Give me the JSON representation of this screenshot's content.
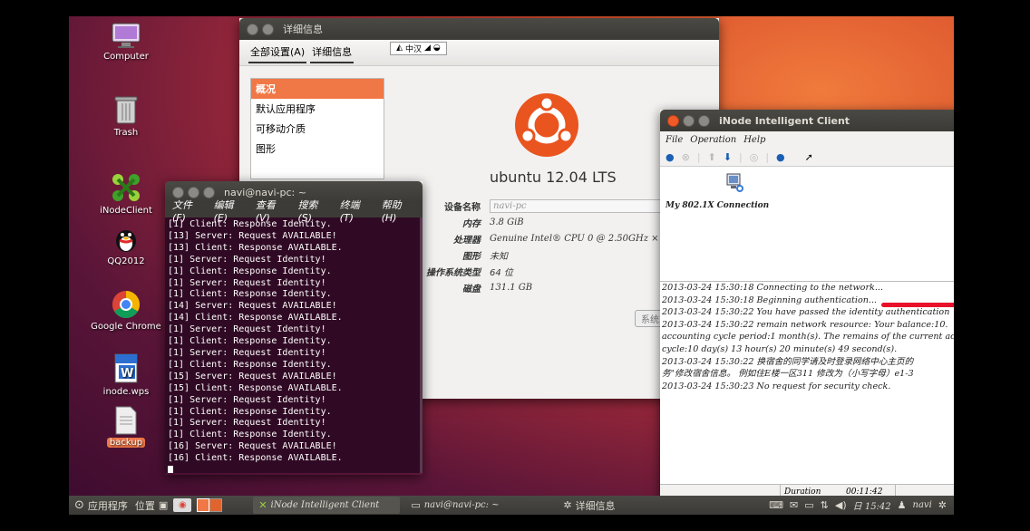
{
  "desktop": {
    "icons": [
      {
        "label": "Computer",
        "icon": "computer-icon"
      },
      {
        "label": "Trash",
        "icon": "trash-icon"
      },
      {
        "label": "iNodeClient",
        "icon": "inode-client-icon"
      },
      {
        "label": "QQ2012",
        "icon": "qq-icon"
      },
      {
        "label": "Google Chrome",
        "icon": "chrome-icon"
      },
      {
        "label": "inode.wps",
        "icon": "wps-document-icon"
      },
      {
        "label": "backup",
        "icon": "text-file-icon"
      }
    ]
  },
  "details": {
    "title": "详细信息",
    "toolbar_all_settings": "全部设置(A)",
    "toolbar_details": "详细信息",
    "ime_label": "中汉",
    "sidebar": [
      "概况",
      "默认应用程序",
      "可移动介质",
      "图形"
    ],
    "os_name": "ubuntu 12.04 LTS",
    "device_name_label": "设备名称",
    "device_name_value": "navi-pc",
    "memory_label": "内存",
    "memory_value": "3.8 GiB",
    "cpu_label": "处理器",
    "cpu_value": "Genuine Intel® CPU 0 @ 2.50GHz × 4",
    "graphics_label": "图形",
    "graphics_value": "未知",
    "ostype_label": "操作系统类型",
    "ostype_value": "64 位",
    "disk_label": "磁盘",
    "disk_value": "131.1 GB",
    "update_button": "系统"
  },
  "terminal": {
    "title": "navi@navi-pc: ~",
    "menu": [
      "文件(F)",
      "编辑(E)",
      "查看(V)",
      "搜索(S)",
      "终端(T)",
      "帮助(H)"
    ],
    "lines": [
      "[1] Client: Response Identity.",
      "[13] Server: Request AVAILABLE!",
      "[13] Client: Response AVAILABLE.",
      "[1] Server: Request Identity!",
      "[1] Client: Response Identity.",
      "[1] Server: Request Identity!",
      "[1] Client: Response Identity.",
      "[14] Server: Request AVAILABLE!",
      "[14] Client: Response AVAILABLE.",
      "[1] Server: Request Identity!",
      "[1] Client: Response Identity.",
      "[1] Server: Request Identity!",
      "[1] Client: Response Identity.",
      "[15] Server: Request AVAILABLE!",
      "[15] Client: Response AVAILABLE.",
      "[1] Server: Request Identity!",
      "[1] Client: Response Identity.",
      "[1] Server: Request Identity!",
      "[1] Client: Response Identity.",
      "[16] Server: Request AVAILABLE!",
      "[16] Client: Response AVAILABLE."
    ]
  },
  "inode": {
    "title": "iNode Intelligent Client",
    "menu": [
      "File",
      "Operation",
      "Help"
    ],
    "connection": "My 802.1X Connection",
    "log": [
      "2013-03-24 15:30:18  Connecting to the network...",
      "2013-03-24 15:30:18  Beginning authentication...",
      "2013-03-24 15:30:22  You have passed the identity authentication",
      "2013-03-24 15:30:22  remain network resource: Your balance:10.",
      "accounting cycle period:1 month(s). The remains of the current acc",
      "cycle:10 day(s) 13 hour(s) 20 minute(s) 49 second(s).",
      "2013-03-24 15:30:22  换宿舍的同学请及时登录网络中心主页的",
      "务\"修改宿舍信息。 例如住E楼一区311 修改为（小写字母）e1-3",
      "2013-03-24 15:30:23  No request for security check."
    ],
    "duration_label": "Duration",
    "duration_value": "00:11:42"
  },
  "panel": {
    "apps_menu": "应用程序",
    "places_menu": "位置",
    "tasks": [
      "iNode Intelligent Client",
      "navi@navi-pc: ~",
      "详细信息"
    ],
    "time": "日 15:42",
    "user": "navi"
  },
  "colors": {
    "accent": "#f07746",
    "terminal_bg": "#300a24",
    "panel_bg": "#3c3b37"
  }
}
